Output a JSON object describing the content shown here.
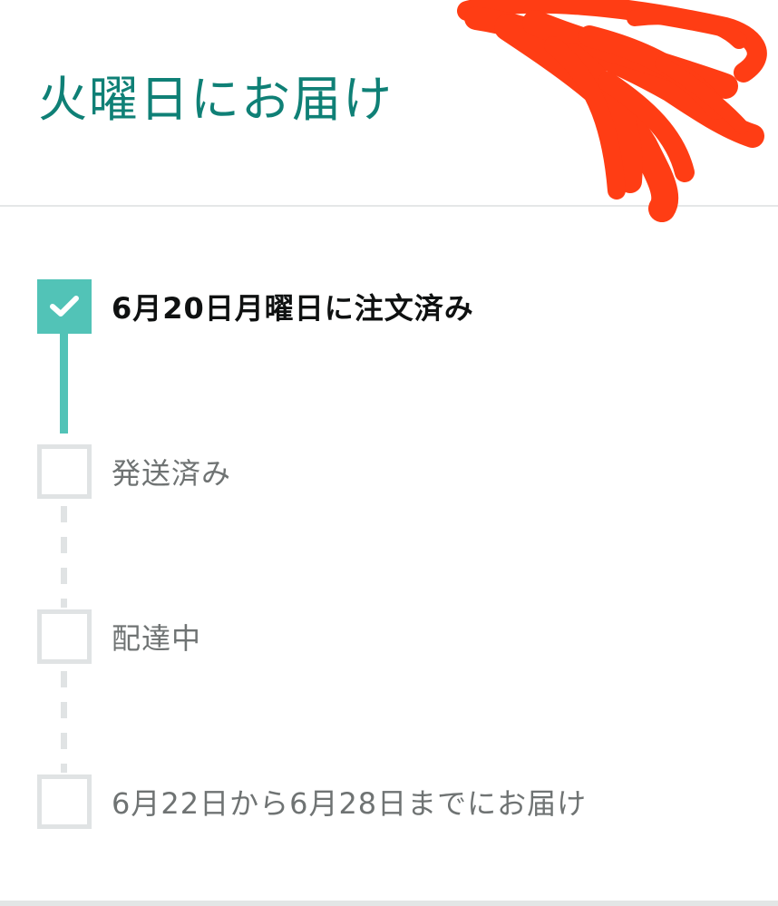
{
  "header": {
    "delivery_title": "火曜日にお届け"
  },
  "tracker": {
    "steps": [
      {
        "label": "6月20日月曜日に注文済み",
        "status": "completed"
      },
      {
        "label": "発送済み",
        "status": "pending"
      },
      {
        "label": "配達中",
        "status": "pending"
      },
      {
        "label": "6月22日から6月28日までにお届け",
        "status": "pending"
      }
    ]
  },
  "icons": {
    "completed_step": "checkmark-icon",
    "pending_step": "empty-checkbox-icon"
  },
  "colors": {
    "title": "#0f8076",
    "completed": "#52c3b7",
    "pending": "#e0e3e4",
    "active_text": "#0f1111",
    "pending_text": "#6f7373",
    "redaction": "#ff3d14"
  }
}
